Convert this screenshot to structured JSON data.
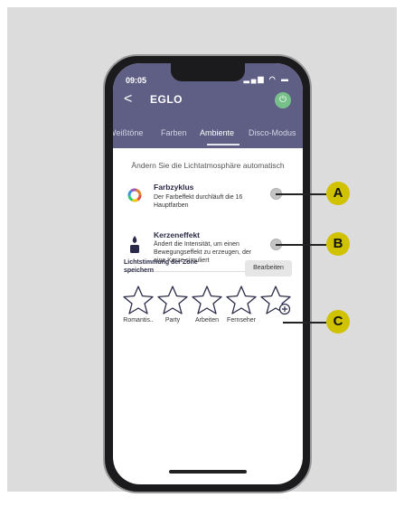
{
  "status_bar": {
    "time": "09:05",
    "icons": "▂▄▆ ◠ ▬"
  },
  "header": {
    "back_label": "<",
    "title": "EGLO"
  },
  "tabs": [
    {
      "label": "Weißtöne"
    },
    {
      "label": "Farben"
    },
    {
      "label": "Ambiente"
    },
    {
      "label": "Disco-Modus"
    }
  ],
  "subtitle": "Ändern Sie die Lichtatmosphäre automatisch",
  "effects": [
    {
      "title": "Farbzyklus",
      "description": "Der Farbeffekt durchläuft die 16 Hauptfarben",
      "icon": "color-wheel-icon"
    },
    {
      "title": "Kerzeneffekt",
      "description": "Ändert die Intensität, um einen Bewegungseffekt zu erzeugen, der eine Kerze simuliert",
      "icon": "candle-icon"
    }
  ],
  "zone": {
    "label": "Lichtstimmung der Zone speichern",
    "edit_label": "Bearbeiten"
  },
  "moods": [
    {
      "label": "Romantis.."
    },
    {
      "label": "Party"
    },
    {
      "label": "Arbeiten"
    },
    {
      "label": "Fernseher"
    }
  ],
  "callouts": [
    "A",
    "B",
    "C"
  ],
  "colors": {
    "app_bar": "#5f5f86",
    "callout": "#d1c200",
    "power": "#78c08a"
  }
}
